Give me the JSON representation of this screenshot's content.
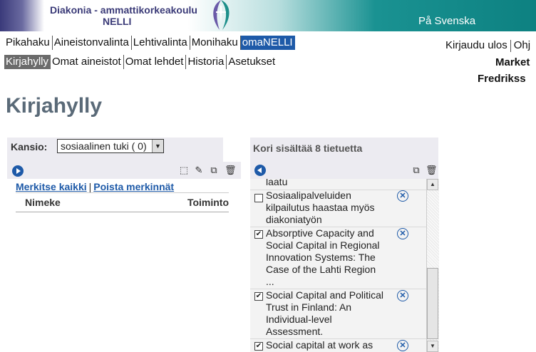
{
  "header": {
    "brand_line1": "Diakonia - ammattikorkeakoulu",
    "brand_line2": "NELLI",
    "language_link": "På Svenska"
  },
  "nav_primary": [
    {
      "label": "Pikahaku",
      "active": false
    },
    {
      "label": "Aineistonvalinta",
      "active": false
    },
    {
      "label": "Lehtivalinta",
      "active": false
    },
    {
      "label": "Monihaku",
      "active": false
    },
    {
      "label": "omaNELLI",
      "active": true
    }
  ],
  "nav_secondary": [
    {
      "label": "Kirjahylly",
      "active": true
    },
    {
      "label": "Omat aineistot",
      "active": false
    },
    {
      "label": "Omat lehdet",
      "active": false
    },
    {
      "label": "Historia",
      "active": false
    },
    {
      "label": "Asetukset",
      "active": false
    }
  ],
  "user_bar": {
    "logout": "Kirjaudu ulos",
    "help": "Ohj",
    "user_line1": "Market",
    "user_line2": "Fredrikss"
  },
  "page_title": "Kirjahylly",
  "folder_panel": {
    "folder_label": "Kansio:",
    "folder_selected": "sosiaalinen tuki ( 0)",
    "select_all": "Merkitse kaikki",
    "separator": "|",
    "clear_marks": "Poista merkinnät",
    "col_title": "Nimeke",
    "col_action": "Toiminto"
  },
  "basket_panel": {
    "title": "Kori sisältää 8 tietuetta",
    "items": [
      {
        "text": "laatu",
        "checked": false,
        "partial": true
      },
      {
        "text": "Sosiaalipalveluiden kilpailutus haastaa myös diakoniatyön",
        "checked": false
      },
      {
        "text": "Absorptive Capacity and Social Capital in Regional Innovation Systems: The Case of the Lahti Region ...",
        "checked": true
      },
      {
        "text": "Social Capital and Political Trust in Finland: An Individual-level Assessment.",
        "checked": true
      },
      {
        "text": "Social capital at work as",
        "checked": true
      }
    ]
  },
  "icons": {
    "check_mark": "✔",
    "remove_glyph": "✕"
  }
}
